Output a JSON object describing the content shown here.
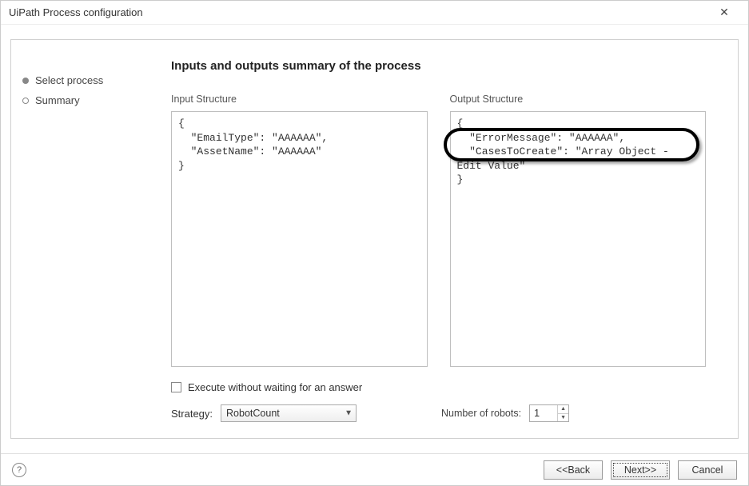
{
  "window": {
    "title": "UiPath Process configuration"
  },
  "sidebar": {
    "items": [
      {
        "label": "Select process",
        "filled": true
      },
      {
        "label": "Summary",
        "filled": false
      }
    ]
  },
  "page": {
    "heading": "Inputs and outputs summary of the process"
  },
  "panels": {
    "input_label": "Input Structure",
    "output_label": "Output Structure",
    "input_text": "{\n  \"EmailType\": \"AAAAAA\",\n  \"AssetName\": \"AAAAAA\"\n}",
    "output_text": "{\n  \"ErrorMessage\": \"AAAAAA\",\n  \"CasesToCreate\": \"Array Object - Edit Value\"\n}"
  },
  "options": {
    "checkbox_label": "Execute without waiting for an answer",
    "strategy_label": "Strategy:",
    "strategy_value": "RobotCount",
    "robots_label": "Number of robots:",
    "robots_value": "1"
  },
  "footer": {
    "back": "<<Back",
    "next": "Next>>",
    "cancel": "Cancel"
  },
  "annotation": {
    "highlighted_output_key": "CasesToCreate"
  }
}
